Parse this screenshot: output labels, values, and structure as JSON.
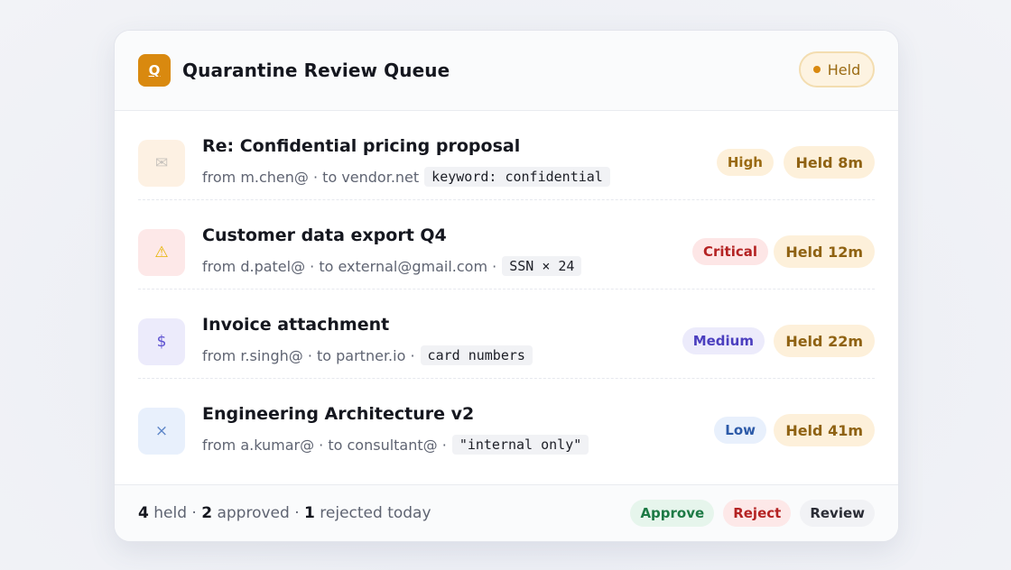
{
  "header": {
    "logo_letter": "Q",
    "title": "Quarantine Review Queue",
    "status_label": "Held"
  },
  "rows": [
    {
      "icon": "mail-icon",
      "icon_glyph": "✉",
      "icon_bg": "#fdf1e3",
      "icon_color": "#c8c3bd",
      "title": "Re: Confidential pricing proposal",
      "meta": "from m.chen@ · to vendor.net",
      "match": "keyword: confidential",
      "severity": "High",
      "severity_bg": "#fdf0da",
      "severity_color": "#9a6a12",
      "held": "Held 8m"
    },
    {
      "icon": "warning-icon",
      "icon_glyph": "⚠",
      "icon_bg": "#fde8e8",
      "icon_color": "#e6b400",
      "title": "Customer data export Q4",
      "meta": "from d.patel@ · to external@gmail.com ·",
      "match": "SSN × 24",
      "severity": "Critical",
      "severity_bg": "#fde6e6",
      "severity_color": "#b42323",
      "held": "Held 12m"
    },
    {
      "icon": "dollar-icon",
      "icon_glyph": "$",
      "icon_bg": "#ecebfb",
      "icon_color": "#5b4fd0",
      "title": "Invoice attachment",
      "meta": "from r.singh@ · to partner.io ·",
      "match": "card numbers",
      "severity": "Medium",
      "severity_bg": "#ecebfb",
      "severity_color": "#4b3fbf",
      "held": "Held 22m"
    },
    {
      "icon": "close-icon",
      "icon_glyph": "×",
      "icon_bg": "#e8f0fc",
      "icon_color": "#5d86c8",
      "title": "Engineering Architecture v2",
      "meta": "from a.kumar@ · to consultant@ ·",
      "match": "\"internal only\"",
      "severity": "Low",
      "severity_bg": "#e8f0fc",
      "severity_color": "#2c5aa8",
      "held": "Held 41m"
    }
  ],
  "footer": {
    "held_count": "4",
    "held_label": "held ·",
    "approved_count": "2",
    "approved_label": "approved ·",
    "rejected_count": "1",
    "rejected_label": "rejected today",
    "approve_label": "Approve",
    "reject_label": "Reject",
    "review_label": "Review"
  },
  "colors": {
    "accent": "#d9890f",
    "approve_bg": "#e6f5ec",
    "approve_fg": "#1d7a45",
    "reject_bg": "#fde8e8",
    "reject_fg": "#b42323",
    "review_bg": "#f1f2f5",
    "review_fg": "#2a2c35"
  }
}
